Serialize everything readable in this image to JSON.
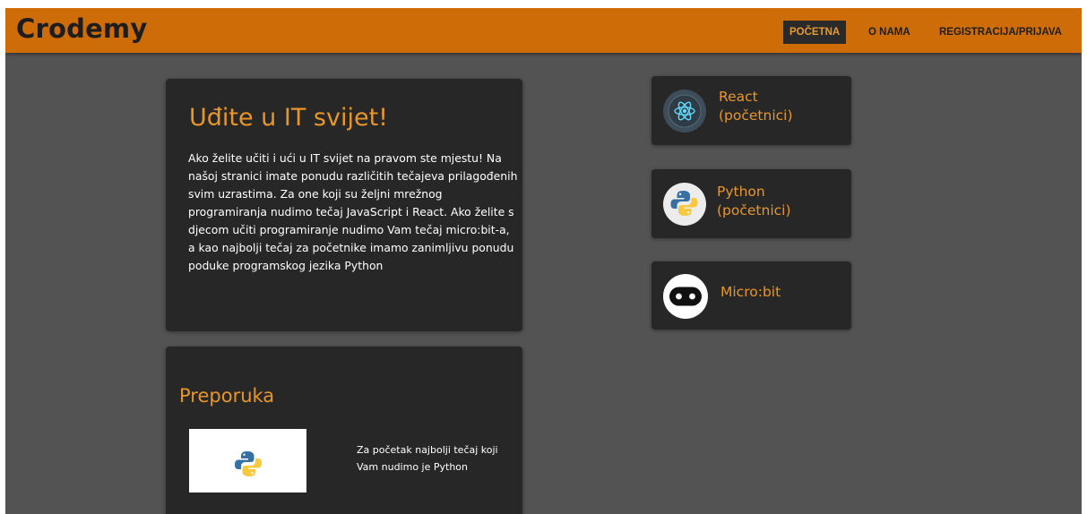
{
  "brand": "Crodemy",
  "nav": {
    "home": "POČETNA",
    "about": "O NAMA",
    "register": "REGISTRACIJA/PRIJAVA"
  },
  "hero": {
    "title": "Uđite u IT svijet!",
    "text": "Ako želite učiti i ući u IT svijet na pravom ste mjestu! Na našoj stranici imate ponudu različitih tečajeva prilagođenih svim uzrastima. Za one koji su željni mrežnog programiranja nudimo tečaj JavaScript i React. Ako želite s djecom učiti programiranje nudimo Vam tečaj micro:bit-a, a kao najbolji tečaj za početnike imamo zanimljivu ponudu poduke programskog jezika Python"
  },
  "recommendation": {
    "title": "Preporuka",
    "text": "Za početak najbolji tečaj koji Vam nudimo je Python"
  },
  "courses": {
    "react": {
      "line1": "React",
      "line2": "(početnici)",
      "icon": "react-icon"
    },
    "python": {
      "line1": "Python",
      "line2": "(početnici)",
      "icon": "python-icon"
    },
    "microbit": {
      "line1": "Micro:bit",
      "icon": "microbit-icon"
    }
  },
  "colors": {
    "navbar": "#ce6c08",
    "background": "#535353",
    "card": "#272727",
    "accent": "#e8962a"
  }
}
